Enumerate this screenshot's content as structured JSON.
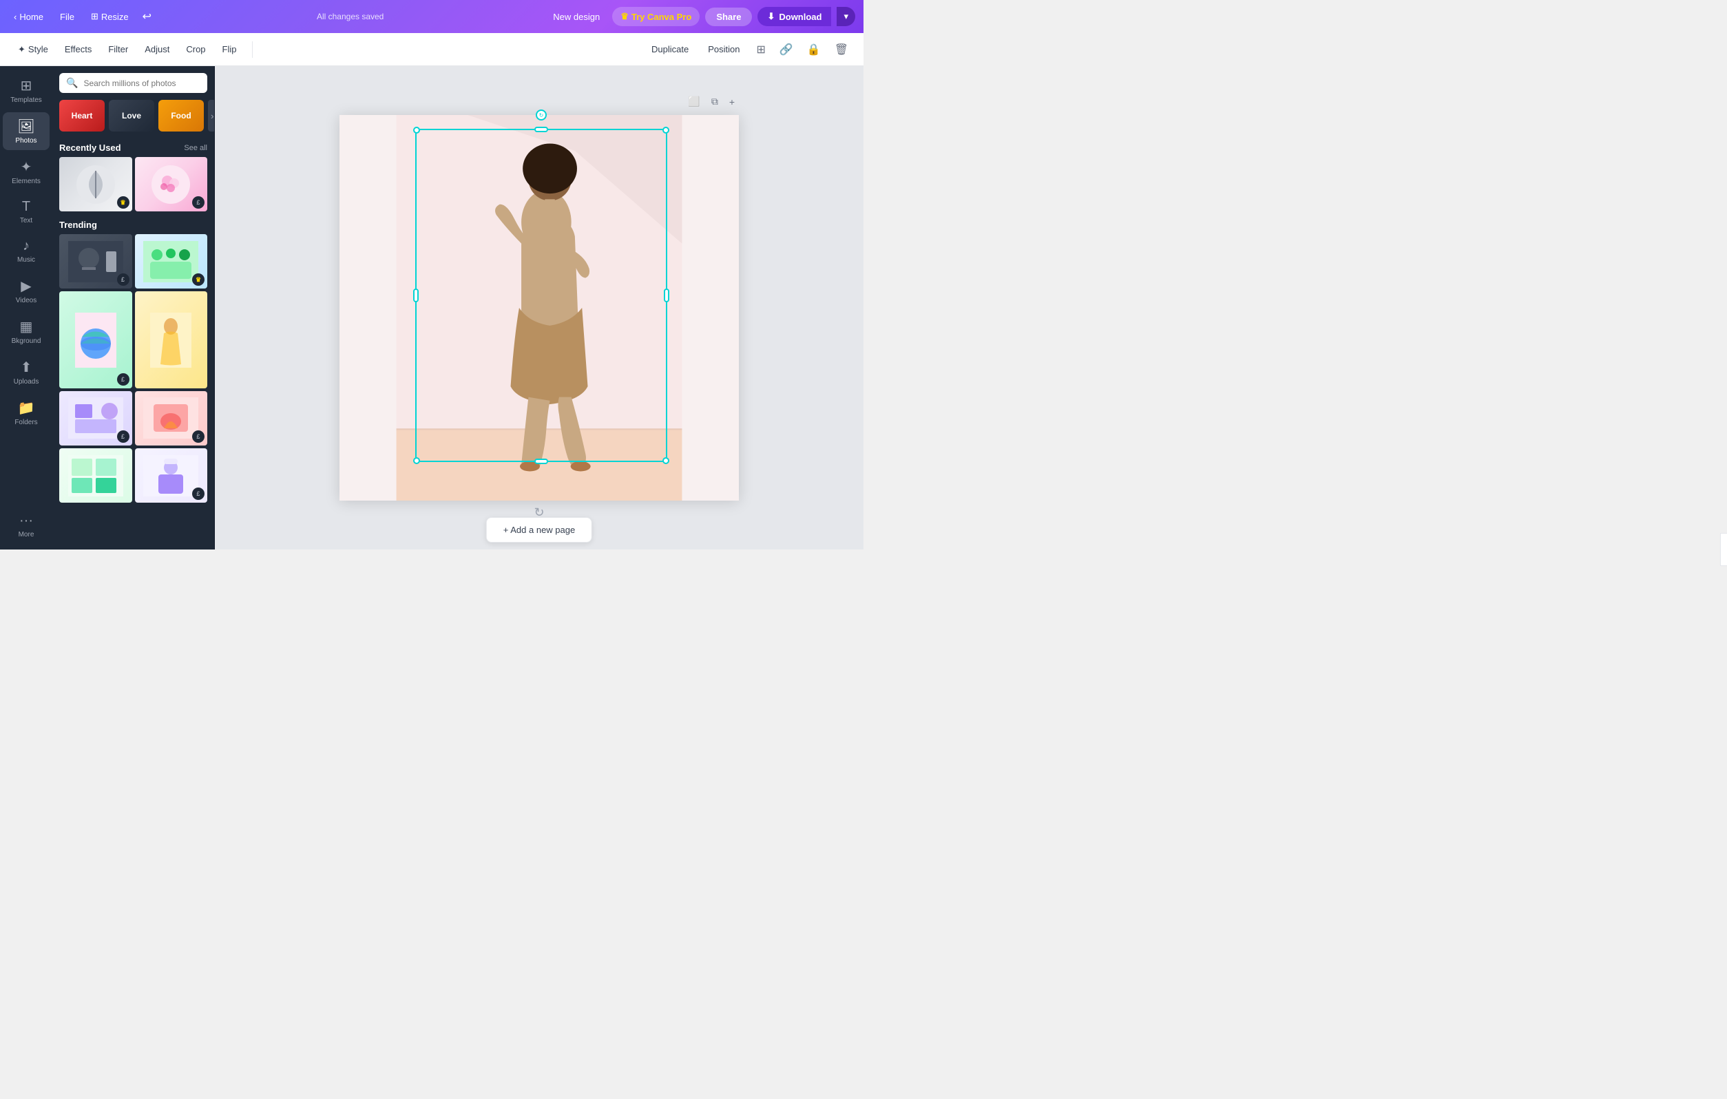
{
  "navbar": {
    "home_label": "Home",
    "file_label": "File",
    "resize_label": "Resize",
    "status": "All changes saved",
    "new_design_label": "New design",
    "try_pro_label": "Try Canva Pro",
    "share_label": "Share",
    "download_label": "Download"
  },
  "toolbar": {
    "style_label": "Style",
    "effects_label": "Effects",
    "filter_label": "Filter",
    "adjust_label": "Adjust",
    "crop_label": "Crop",
    "flip_label": "Flip",
    "duplicate_label": "Duplicate",
    "position_label": "Position"
  },
  "sidebar": {
    "items": [
      {
        "label": "Templates",
        "icon": "⊞"
      },
      {
        "label": "Photos",
        "icon": "🖼"
      },
      {
        "label": "Elements",
        "icon": "✦"
      },
      {
        "label": "Text",
        "icon": "T"
      },
      {
        "label": "Music",
        "icon": "♪"
      },
      {
        "label": "Videos",
        "icon": "▶"
      },
      {
        "label": "Bkground",
        "icon": "▦"
      },
      {
        "label": "Uploads",
        "icon": "↑"
      },
      {
        "label": "Folders",
        "icon": "📁"
      },
      {
        "label": "More",
        "icon": "···"
      }
    ]
  },
  "photos_panel": {
    "search_placeholder": "Search millions of photos",
    "categories": [
      {
        "label": "Heart",
        "class": "chip-heart"
      },
      {
        "label": "Love",
        "class": "chip-love"
      },
      {
        "label": "Food",
        "class": "chip-food"
      }
    ],
    "recently_used_title": "Recently Used",
    "see_all_label": "See all",
    "trending_title": "Trending"
  },
  "canvas": {
    "add_page_label": "+ Add a new page"
  }
}
